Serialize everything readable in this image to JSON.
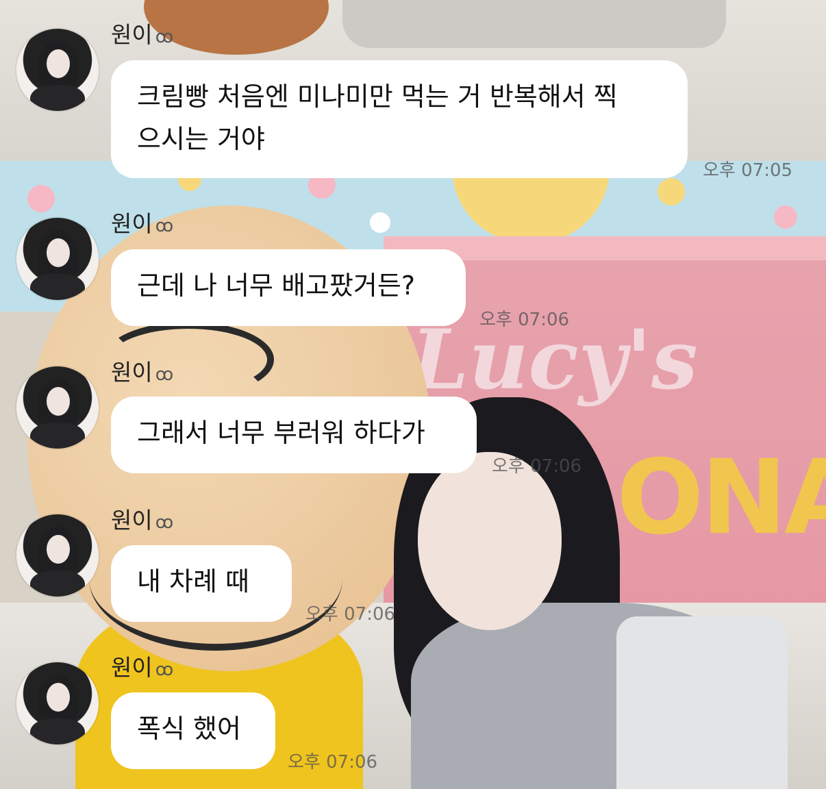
{
  "chat": {
    "messages": [
      {
        "sender": "원이",
        "badge": "ꝏ",
        "text": "크림빵 처음엔 미나미만 먹는 거 반복해서 찍으시는 거야",
        "line1": "크림빵 처음엔 미나미만 먹는 거 반복해서 찍",
        "line2": "으시는 거야",
        "time": "오후 07:05"
      },
      {
        "sender": "원이",
        "badge": "ꝏ",
        "text": "근데 나 너무 배고팠거든?",
        "time": "오후 07:06"
      },
      {
        "sender": "원이",
        "badge": "ꝏ",
        "text": "그래서 너무 부러워 하다가",
        "time": "오후 07:06"
      },
      {
        "sender": "원이",
        "badge": "ꝏ",
        "text": "내 차례 때",
        "time": "오후 07:06"
      },
      {
        "sender": "원이",
        "badge": "ꝏ",
        "text": "폭식 했어",
        "time": "오후 07:06"
      }
    ]
  },
  "background": {
    "sign_text": "Lucy's",
    "sign_text2": "ONA"
  },
  "colors": {
    "bubble": "#ffffff",
    "timestamp": "#555555",
    "sender": "#222222"
  }
}
